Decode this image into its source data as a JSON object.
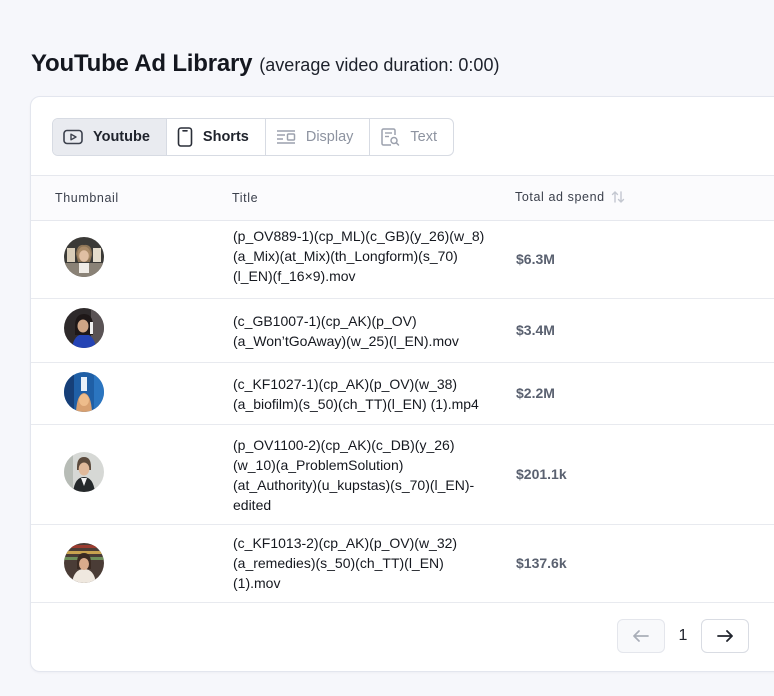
{
  "header": {
    "title": "YouTube Ad Library",
    "subtitle": "(average video duration: 0:00)"
  },
  "tabs": [
    {
      "label": "Youtube",
      "icon": "youtube-icon",
      "state": "active"
    },
    {
      "label": "Shorts",
      "icon": "shorts-phone-icon",
      "state": "enabled"
    },
    {
      "label": "Display",
      "icon": "display-layout-icon",
      "state": "disabled"
    },
    {
      "label": "Text",
      "icon": "text-search-icon",
      "state": "disabled"
    }
  ],
  "table": {
    "columns": {
      "thumbnail": "Thumbnail",
      "title": "Title",
      "spend": "Total ad spend"
    },
    "rows": [
      {
        "title_lines": [
          "(p_OV889-1)(cp_ML)(c_GB)(y_26)(w_8)",
          "(a_Mix)(at_Mix)(th_Longform)(s_70)",
          "(l_EN)(f_16×9).mov"
        ],
        "spend": "$6.3M"
      },
      {
        "title_lines": [
          "(c_GB1007-1)(cp_AK)(p_OV)",
          "(a_Won’tGoAway)(w_25)(l_EN).mov"
        ],
        "spend": "$3.4M"
      },
      {
        "title_lines": [
          "(c_KF1027-1)(cp_AK)(p_OV)(w_38)",
          "(a_biofilm)(s_50)(ch_TT)(l_EN) (1).mp4"
        ],
        "spend": "$2.2M"
      },
      {
        "title_lines": [
          "(p_OV1100-2)(cp_AK)(c_DB)(y_26)",
          "(w_10)(a_ProblemSolution)",
          "(at_Authority)(u_kupstas)(s_70)(l_EN)-",
          "edited"
        ],
        "spend": "$201.1k"
      },
      {
        "title_lines": [
          "(c_KF1013-2)(cp_AK)(p_OV)(w_32)",
          "(a_remedies)(s_50)(ch_TT)(l_EN)",
          "(1).mov"
        ],
        "spend": "$137.6k"
      }
    ]
  },
  "pagination": {
    "current_page": "1",
    "prev_state": "disabled",
    "next_state": "enabled"
  }
}
